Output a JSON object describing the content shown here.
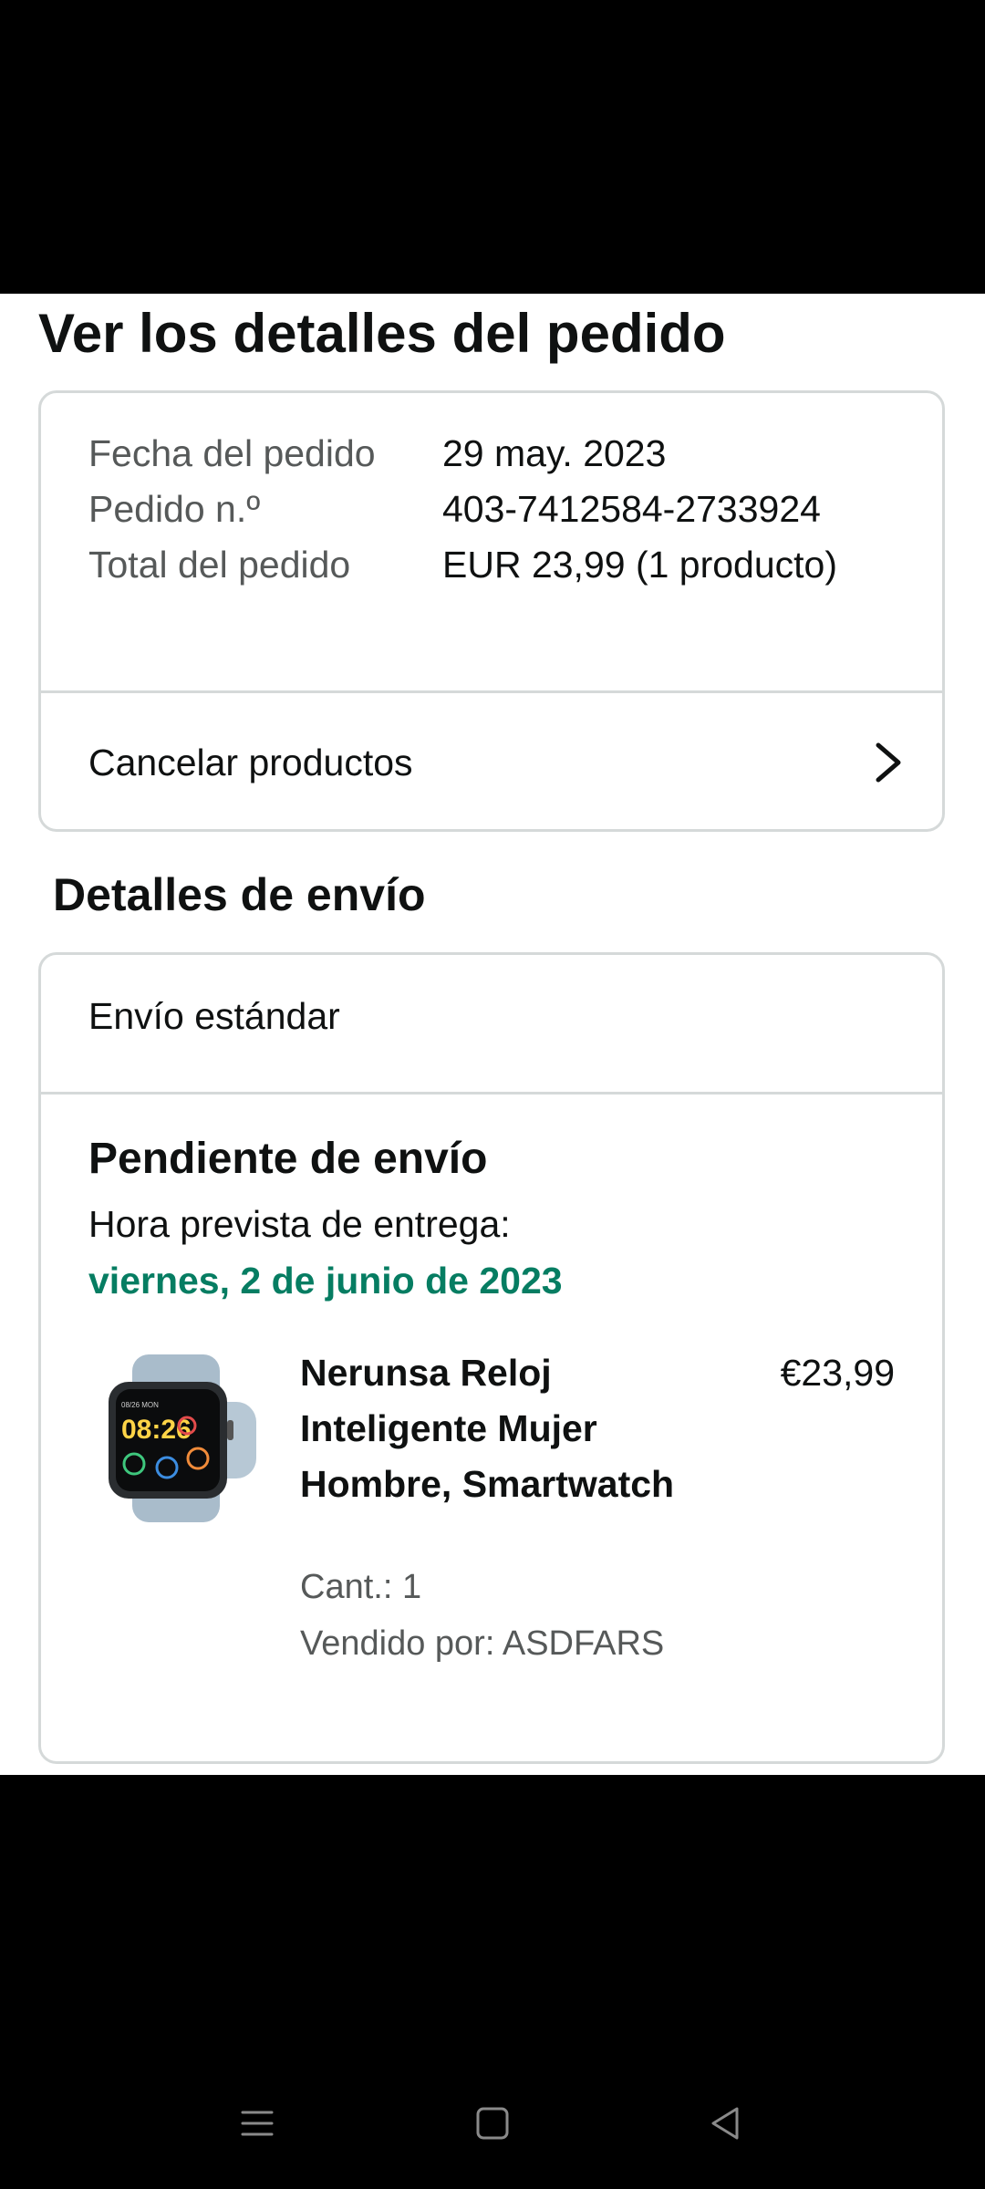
{
  "page": {
    "title": "Ver los detalles del pedido"
  },
  "order_summary": {
    "rows": [
      {
        "label": "Fecha del pedido",
        "value": "29 may. 2023"
      },
      {
        "label": "Pedido n.º",
        "value": "403-7412584-2733924"
      },
      {
        "label": "Total del pedido",
        "value": "EUR 23,99 (1 producto)"
      }
    ],
    "cancel_label": "Cancelar productos"
  },
  "shipping": {
    "section_title": "Detalles de envío",
    "method": "Envío estándar",
    "status": "Pendiente de envío",
    "eta_label": "Hora prevista de entrega:",
    "eta_date": "viernes, 2 de junio de 2023",
    "product": {
      "name": "Nerunsa Reloj Inteligente Mujer Hombre, Smartwatch",
      "price": "€23,99",
      "quantity": "Cant.: 1",
      "seller": "Vendido por: ASDFARS",
      "image_icon": "smartwatch-image",
      "watch_time": "08:26"
    }
  },
  "navigation_bar": {
    "icons": [
      "menu-icon",
      "home-square-icon",
      "back-triangle-icon"
    ]
  },
  "colors": {
    "accent_green": "#067d62",
    "secondary_text": "#565959",
    "border": "#d5d9d9"
  }
}
